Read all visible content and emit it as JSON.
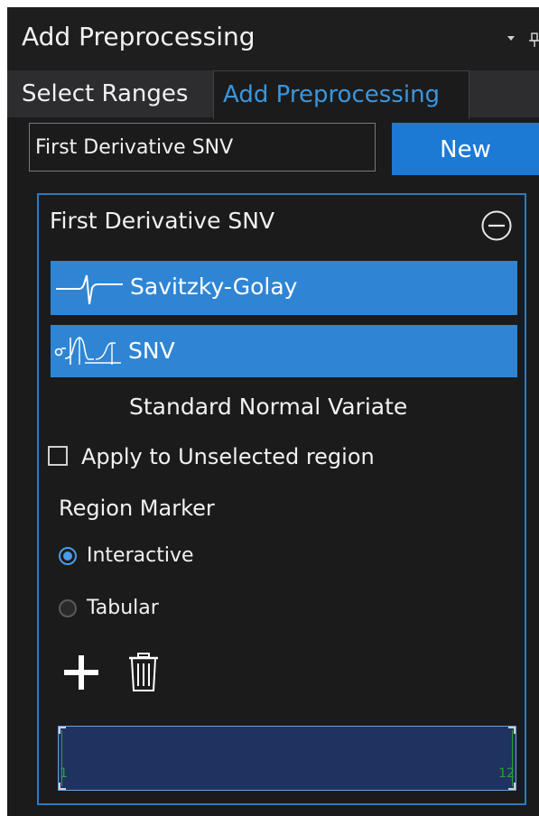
{
  "window": {
    "title": "Add Preprocessing",
    "icons": [
      "dropdown-arrow-icon",
      "pin-icon"
    ]
  },
  "tabs": [
    {
      "label": "Select Ranges",
      "active": false
    },
    {
      "label": "Add Preprocessing",
      "active": true
    }
  ],
  "toolbar": {
    "name_value": "First Derivative SNV",
    "new_label": "New"
  },
  "group": {
    "title": "First Derivative SNV",
    "collapse_icon": "minus-circle-icon",
    "steps": [
      {
        "label": "Savitzky-Golay",
        "icon": "derivative-wave-icon"
      },
      {
        "label": "SNV",
        "icon": "snv-distribution-icon"
      }
    ],
    "step_description": "Standard Normal Variate",
    "apply_unselected": {
      "label": "Apply to Unselected region",
      "checked": false
    },
    "region_marker": {
      "label": "Region Marker",
      "options": [
        {
          "label": "Interactive",
          "selected": true
        },
        {
          "label": "Tabular",
          "selected": false
        }
      ]
    },
    "actions": {
      "add_icon": "plus-icon",
      "delete_icon": "trash-icon"
    },
    "region": {
      "start": "1",
      "end": "12"
    }
  },
  "colors": {
    "panel_bg": "#1b1b1b",
    "accent": "#1c7ad4",
    "step_bg": "#2f85d4",
    "active_tab_text": "#3a96dd",
    "region_fill": "#1f3361",
    "marker_green": "#2e9e3a"
  }
}
